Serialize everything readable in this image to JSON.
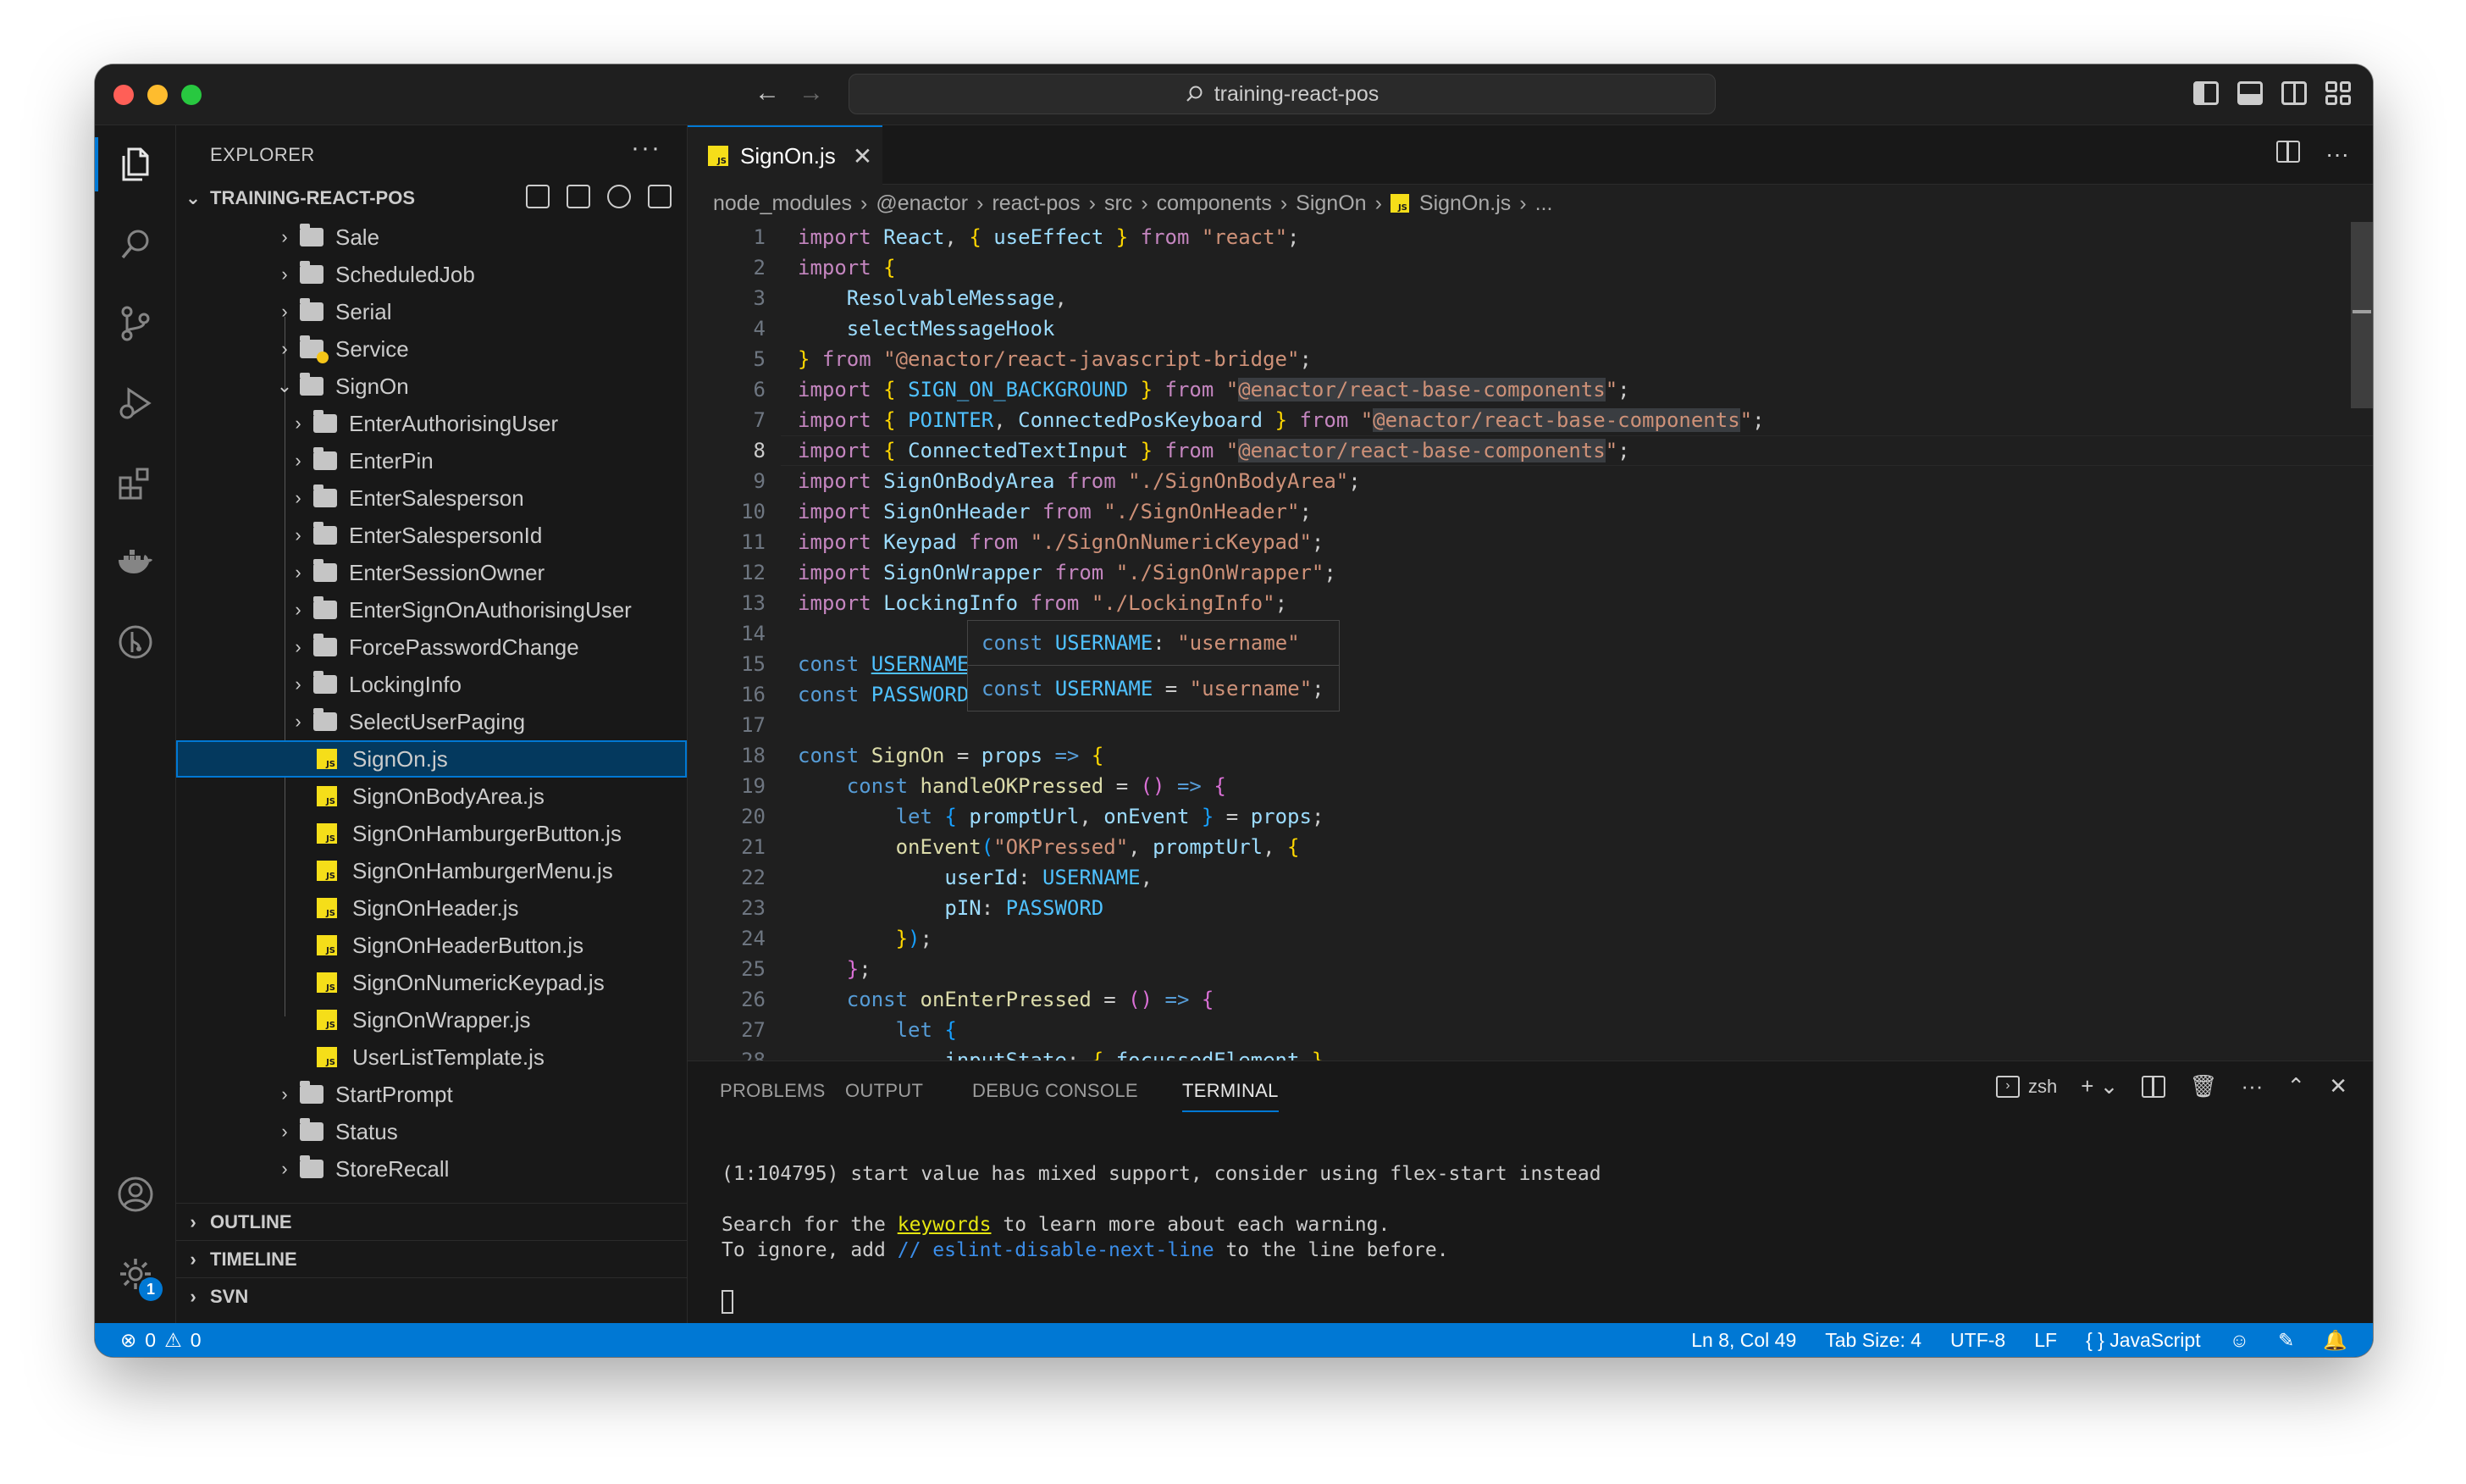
{
  "window": {
    "search_text": "training-react-pos"
  },
  "sidebar": {
    "title": "EXPLORER",
    "more": "···",
    "root": "TRAINING-REACT-POS",
    "items": [
      {
        "label": "Sale",
        "type": "folder"
      },
      {
        "label": "ScheduledJob",
        "type": "folder"
      },
      {
        "label": "Serial",
        "type": "folder"
      },
      {
        "label": "Service",
        "type": "folder-special"
      },
      {
        "label": "SignOn",
        "type": "folder-open"
      },
      {
        "label": "EnterAuthorisingUser",
        "type": "subfolder"
      },
      {
        "label": "EnterPin",
        "type": "subfolder"
      },
      {
        "label": "EnterSalesperson",
        "type": "subfolder"
      },
      {
        "label": "EnterSalespersonId",
        "type": "subfolder"
      },
      {
        "label": "EnterSessionOwner",
        "type": "subfolder"
      },
      {
        "label": "EnterSignOnAuthorisingUser",
        "type": "subfolder"
      },
      {
        "label": "ForcePasswordChange",
        "type": "subfolder"
      },
      {
        "label": "LockingInfo",
        "type": "subfolder"
      },
      {
        "label": "SelectUserPaging",
        "type": "subfolder"
      },
      {
        "label": "SignOn.js",
        "type": "file"
      },
      {
        "label": "SignOnBodyArea.js",
        "type": "file"
      },
      {
        "label": "SignOnHamburgerButton.js",
        "type": "file"
      },
      {
        "label": "SignOnHamburgerMenu.js",
        "type": "file"
      },
      {
        "label": "SignOnHeader.js",
        "type": "file"
      },
      {
        "label": "SignOnHeaderButton.js",
        "type": "file"
      },
      {
        "label": "SignOnNumericKeypad.js",
        "type": "file"
      },
      {
        "label": "SignOnWrapper.js",
        "type": "file"
      },
      {
        "label": "UserListTemplate.js",
        "type": "file"
      },
      {
        "label": "StartPrompt",
        "type": "folder"
      },
      {
        "label": "Status",
        "type": "folder"
      },
      {
        "label": "StoreRecall",
        "type": "folder"
      }
    ],
    "selected_item": "SignOn.js",
    "sections": [
      "OUTLINE",
      "TIMELINE",
      "SVN"
    ],
    "js_badge": "JS"
  },
  "editor": {
    "tab_label": "SignOn.js",
    "breadcrumb": [
      "node_modules",
      "@enactor",
      "react-pos",
      "src",
      "components",
      "SignOn",
      "SignOn.js",
      "..."
    ],
    "line_numbers": [
      "1",
      "2",
      "3",
      "4",
      "5",
      "6",
      "7",
      "8",
      "9",
      "10",
      "11",
      "12",
      "13",
      "14",
      "15",
      "16",
      "17",
      "18",
      "19",
      "20",
      "21",
      "22",
      "23",
      "24",
      "25",
      "26",
      "27",
      "28"
    ],
    "current_line": "8",
    "lines": [
      "import React, { useEffect } from \"react\";",
      "import {",
      "    ResolvableMessage,",
      "    selectMessageHook",
      "} from \"@enactor/react-javascript-bridge\";",
      "import { SIGN_ON_BACKGROUND } from \"@enactor/react-base-components\";",
      "import { POINTER, ConnectedPosKeyboard } from \"@enactor/react-base-components\";",
      "import { ConnectedTextInput } from \"@enactor/react-base-components\";",
      "import SignOnBodyArea from \"./SignOnBodyArea\";",
      "import SignOnHeader from \"./SignOnHeader\";",
      "import Keypad from \"./SignOnNumericKeypad\";",
      "import SignOnWrapper from \"./SignOnWrapper\";",
      "import LockingInfo from \"./LockingInfo\";",
      "",
      "const USERNAME = \"username\";",
      "const PASSWORD = \"password\";",
      "",
      "const SignOn = props => {",
      "    const handleOKPressed = () => {",
      "        let { promptUrl, onEvent } = props;",
      "        onEvent(\"OKPressed\", promptUrl, {",
      "            userId: USERNAME,",
      "            pIN: PASSWORD",
      "        });",
      "    };",
      "    const onEnterPressed = () => {",
      "        let {",
      "            inputState: { focussedElement }"
    ],
    "hover": {
      "line1": "const USERNAME: \"username\"",
      "line2": "const USERNAME = \"username\";"
    }
  },
  "panel": {
    "tabs": [
      "PROBLEMS",
      "OUTPUT",
      "DEBUG CONSOLE",
      "TERMINAL"
    ],
    "active_tab": "TERMINAL",
    "shell": "zsh",
    "terminal_lines": {
      "l1": "(1:104795) start value has mixed support, consider using flex-start instead",
      "l2_pre": "Search for the ",
      "l2_link": "keywords",
      "l2_post": " to learn more about each warning.",
      "l3_pre": "To ignore, add ",
      "l3_comment": "// eslint-disable-next-line",
      "l3_post": " to the line before."
    }
  },
  "statusbar": {
    "errors": "0",
    "warnings": "0",
    "position": "Ln 8, Col 49",
    "tab_size": "Tab Size: 4",
    "encoding": "UTF-8",
    "eol": "LF",
    "language": "JavaScript"
  },
  "accounts_badge": "1",
  "colors": {
    "accent": "#0078d4",
    "keyword": "#569cd6",
    "control": "#c586c0",
    "string": "#ce9178",
    "js_icon": "#f5de19"
  }
}
